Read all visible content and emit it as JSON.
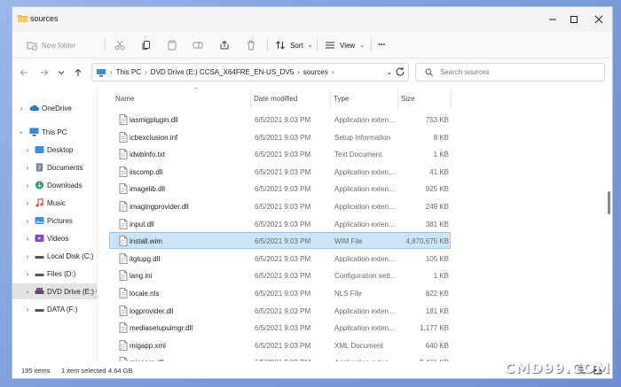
{
  "window": {
    "title": "sources"
  },
  "toolbar": {
    "new_folder": "New folder",
    "sort": "Sort",
    "view": "View",
    "more": "···"
  },
  "address": {
    "crumbs": [
      "This PC",
      "DVD Drive (E:) CCSA_X64FRE_EN-US_DV5",
      "sources"
    ],
    "search_placeholder": "Search sources"
  },
  "nav": {
    "items": [
      {
        "label": "OneDrive"
      },
      {
        "label": "This PC"
      },
      {
        "label": "Desktop"
      },
      {
        "label": "Documents"
      },
      {
        "label": "Downloads"
      },
      {
        "label": "Music"
      },
      {
        "label": "Pictures"
      },
      {
        "label": "Videos"
      },
      {
        "label": "Local Disk (C:)"
      },
      {
        "label": "Files (D:)"
      },
      {
        "label": "DVD Drive (E:) CC"
      },
      {
        "label": "DATA (F:)"
      }
    ]
  },
  "columns": {
    "name": "Name",
    "date": "Date modified",
    "type": "Type",
    "size": "Size"
  },
  "files": [
    {
      "name": "iasmigplugin.dll",
      "date": "6/5/2021 9:03 PM",
      "type": "Application exten...",
      "size": "753 KB"
    },
    {
      "name": "icbexclusion.inf",
      "date": "6/5/2021 9:03 PM",
      "type": "Setup Information",
      "size": "8 KB"
    },
    {
      "name": "idwbinfo.txt",
      "date": "6/5/2021 9:03 PM",
      "type": "Text Document",
      "size": "1 KB"
    },
    {
      "name": "iiscomp.dll",
      "date": "6/5/2021 9:03 PM",
      "type": "Application exten...",
      "size": "41 KB"
    },
    {
      "name": "imagelib.dll",
      "date": "6/5/2021 9:03 PM",
      "type": "Application exten...",
      "size": "925 KB"
    },
    {
      "name": "imagingprovider.dll",
      "date": "6/5/2021 9:03 PM",
      "type": "Application exten...",
      "size": "249 KB"
    },
    {
      "name": "input.dll",
      "date": "6/5/2021 9:03 PM",
      "type": "Application exten...",
      "size": "381 KB"
    },
    {
      "name": "install.wim",
      "date": "6/5/2021 9:03 PM",
      "type": "WIM File",
      "size": "4,870,675 KB"
    },
    {
      "name": "itgtupg.dll",
      "date": "6/5/2021 9:03 PM",
      "type": "Application exten...",
      "size": "105 KB"
    },
    {
      "name": "lang.ini",
      "date": "6/5/2021 9:03 PM",
      "type": "Configuration sett...",
      "size": "1 KB"
    },
    {
      "name": "locale.nls",
      "date": "6/5/2021 9:03 PM",
      "type": "NLS File",
      "size": "822 KB"
    },
    {
      "name": "logprovider.dll",
      "date": "6/5/2021 9:03 PM",
      "type": "Application exten...",
      "size": "181 KB"
    },
    {
      "name": "mediasetupuimgr.dll",
      "date": "6/5/2021 9:03 PM",
      "type": "Application exten...",
      "size": "1,177 KB"
    },
    {
      "name": "migapp.xml",
      "date": "6/5/2021 9:03 PM",
      "type": "XML Document",
      "size": "640 KB"
    },
    {
      "name": "migcore.dll",
      "date": "6/5/2021 9:03 PM",
      "type": "Application exten...",
      "size": "9,481 KB"
    }
  ],
  "status": {
    "items": "195 items",
    "selected": "1 item selected",
    "sel_size": "4.64 GB"
  },
  "watermark": "CMD99.COM"
}
